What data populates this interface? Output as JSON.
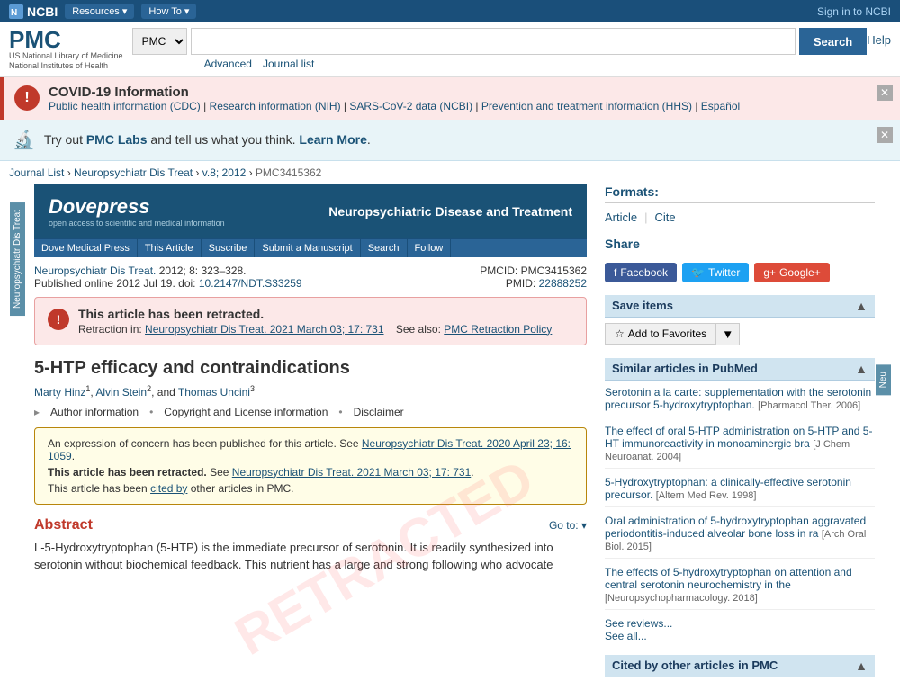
{
  "topnav": {
    "ncbi_label": "NCBI",
    "resources_label": "Resources",
    "howto_label": "How To",
    "signin_label": "Sign in to NCBI"
  },
  "header": {
    "pmc_title": "PMC",
    "pmc_subtitle_line1": "US National Library of Medicine",
    "pmc_subtitle_line2": "National Institutes of Health",
    "search_dropdown_value": "PMC",
    "search_placeholder": "",
    "search_button": "Search",
    "advanced_link": "Advanced",
    "journal_list_link": "Journal list",
    "help_link": "Help"
  },
  "covid_banner": {
    "title": "COVID-19 Information",
    "links": [
      "Public health information (CDC)",
      "Research information (NIH)",
      "SARS-CoV-2 data (NCBI)",
      "Prevention and treatment information (HHS)",
      "Español"
    ]
  },
  "labs_banner": {
    "text_before": "Try out ",
    "link_text": "PMC Labs",
    "text_after": " and tell us what you think. ",
    "learn_more": "Learn More",
    "period": "."
  },
  "breadcrumb": {
    "items": [
      "Journal List",
      "Neuropsychiatr Dis Treat",
      "v.8; 2012",
      "PMC3415362"
    ]
  },
  "journal_header": {
    "logo_name": "Dovepress",
    "logo_sub": "open access to scientific and medical information",
    "journal_title": "Neuropsychiatric Disease and Treatment",
    "nav_items": [
      "Dove Medical Press",
      "This Article",
      "Suscribe",
      "Submit a Manuscript",
      "Search",
      "Follow"
    ]
  },
  "article_meta": {
    "journal_abbr": "Neuropsychiatr Dis Treat.",
    "year_vol": "2012; 8: 323–328.",
    "pub_date": "Published online 2012 Jul 19.",
    "doi_label": "doi:",
    "doi_value": "10.2147/NDT.S33259",
    "pmcid_label": "PMCID:",
    "pmcid_value": "PMC3415362",
    "pmid_label": "PMID:",
    "pmid_value": "22888252"
  },
  "retraction": {
    "title": "This article has been retracted.",
    "retraction_label": "Retraction in:",
    "retraction_ref": "Neuropsychiatr Dis Treat. 2021 March 03; 17: 731",
    "see_also": "See also:",
    "pmc_policy": "PMC Retraction Policy"
  },
  "article": {
    "title": "5-HTP efficacy and contraindications",
    "authors": [
      {
        "name": "Marty Hinz",
        "sup": "1"
      },
      {
        "name": "Alvin Stein",
        "sup": "2"
      },
      {
        "name": "Thomas Uncini",
        "sup": "3"
      }
    ],
    "author_connector": "and",
    "info_links": [
      "Author information",
      "Copyright and License information",
      "Disclaimer"
    ]
  },
  "concern_box": {
    "line1_prefix": "An expression of concern has been published for this article. See ",
    "line1_link": "Neuropsychiatr Dis Treat. 2020 April 23; 16: 1059",
    "line2_prefix": "This article has been retracted.",
    "line2_text": " See ",
    "line2_link": "Neuropsychiatr Dis Treat. 2021 March 03; 17: 731",
    "line3": "This article has been ",
    "line3_link": "cited by",
    "line3_suffix": " other articles in PMC."
  },
  "abstract": {
    "title": "Abstract",
    "goto_label": "Go to:",
    "text": "L-5-Hydroxytryptophan (5-HTP) is the immediate precursor of serotonin. It is readily synthesized into serotonin without biochemical feedback. This nutrient has a large and strong following who advocate"
  },
  "sidebar": {
    "formats_title": "Formats:",
    "format_items": [
      "Article",
      "Cite"
    ],
    "share_title": "Share",
    "share_items": [
      {
        "label": "Facebook",
        "type": "facebook"
      },
      {
        "label": "Twitter",
        "type": "twitter"
      },
      {
        "label": "Google+",
        "type": "google"
      }
    ],
    "save_title": "Save items",
    "save_button": "Add to Favorites",
    "similar_title": "Similar articles in PubMed",
    "similar_items": [
      {
        "title": "Serotonin a la carte: supplementation with the serotonin precursor 5-hydroxytryptophan.",
        "ref": "[Pharmacol Ther. 2006]"
      },
      {
        "title": "The effect of oral 5-HTP administration on 5-HTP and 5-HT immunoreactivity in monoaminergic bra",
        "ref": "[J Chem Neuroanat. 2004]"
      },
      {
        "title": "5-Hydroxytryptophan: a clinically-effective serotonin precursor.",
        "ref": "[Altern Med Rev. 1998]"
      },
      {
        "title": "Oral administration of 5-hydroxytryptophan aggravated periodontitis-induced alveolar bone loss in ra",
        "ref": "[Arch Oral Biol. 2015]"
      },
      {
        "title": "The effects of 5-hydroxytryptophan on attention and central serotonin neurochemistry in the",
        "ref": "[Neuropsychopharmacology. 2018]"
      }
    ],
    "see_reviews": "See reviews...",
    "see_all": "See all...",
    "cited_title": "Cited by other articles in PMC"
  },
  "side_tabs": {
    "left_tab1": "Neuropsychiatr Dis Treat",
    "right_tab": "Neu"
  }
}
